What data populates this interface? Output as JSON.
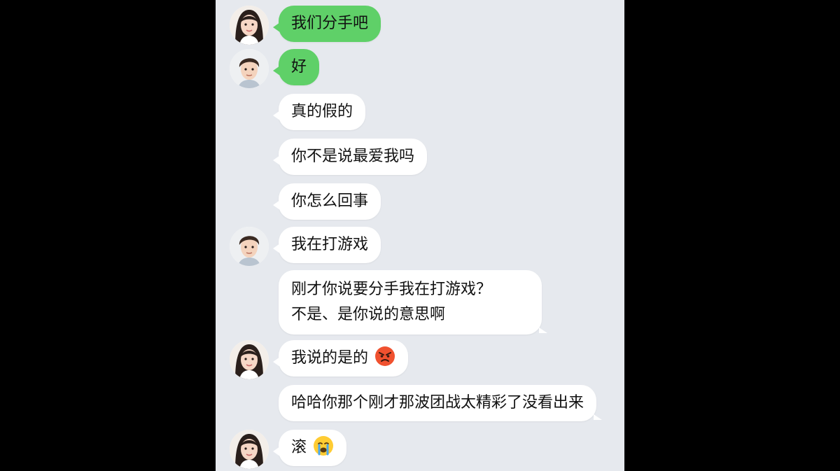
{
  "colors": {
    "panel_bg": "#e6e9ee",
    "outer_bg": "#000000",
    "bubble_green": "#5fd068",
    "bubble_white": "#ffffff",
    "text": "#111111"
  },
  "messages": [
    {
      "sender": "girl",
      "avatar": "girl-avatar",
      "color": "green",
      "text": "我们分手吧"
    },
    {
      "sender": "boy",
      "avatar": "boy-avatar",
      "color": "green",
      "text": "好"
    },
    {
      "sender": "girl",
      "avatar": null,
      "color": "white",
      "text": "真的假的"
    },
    {
      "sender": "girl",
      "avatar": null,
      "color": "white",
      "text": "你不是说最爱我吗"
    },
    {
      "sender": "girl",
      "avatar": null,
      "color": "white",
      "text": "你怎么回事"
    },
    {
      "sender": "boy",
      "avatar": "boy-avatar",
      "color": "white",
      "text": "我在打游戏"
    },
    {
      "sender": "boy",
      "avatar": null,
      "color": "white",
      "lines": [
        "刚才你说要分手我在打游戏？",
        "不是、是你说的意思啊"
      ]
    },
    {
      "sender": "girl",
      "avatar": "girl-avatar",
      "color": "white",
      "text": "我说的是的",
      "emoji": "angry-face-emoji"
    },
    {
      "sender": "girl",
      "avatar": null,
      "color": "white",
      "text": "哈哈你那个刚才那波团战太精彩了没看出来"
    },
    {
      "sender": "girl",
      "avatar": "girl-avatar",
      "color": "white",
      "text": "滚",
      "emoji": "crying-face-emoji"
    }
  ]
}
